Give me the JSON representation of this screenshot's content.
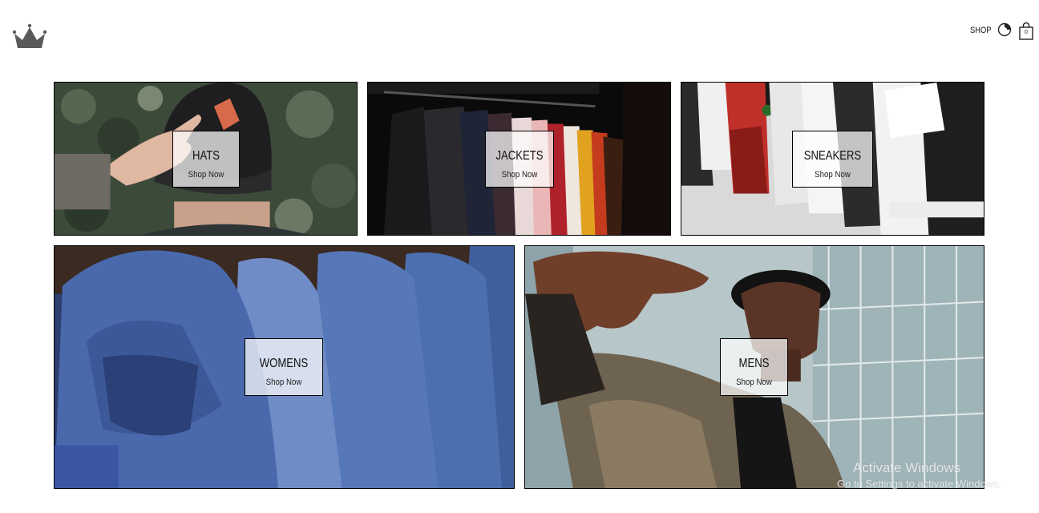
{
  "header": {
    "logo_icon": "crown-icon",
    "nav_shop_label": "SHOP",
    "user_icon": "user-icon",
    "cart_icon": "shopping-bag-icon",
    "cart_count": "0"
  },
  "tiles": [
    {
      "title": "HATS",
      "cta": "Shop Now"
    },
    {
      "title": "JACKETS",
      "cta": "Shop Now"
    },
    {
      "title": "SNEAKERS",
      "cta": "Shop Now"
    },
    {
      "title": "WOMENS",
      "cta": "Shop Now"
    },
    {
      "title": "MENS",
      "cta": "Shop Now"
    }
  ],
  "watermark": {
    "title": "Activate Windows",
    "subtitle": "Go to Settings to activate Windows."
  },
  "colors": {
    "logo": "#5a5a5a",
    "border": "#000000",
    "label_bg": "#ffffffb8"
  }
}
